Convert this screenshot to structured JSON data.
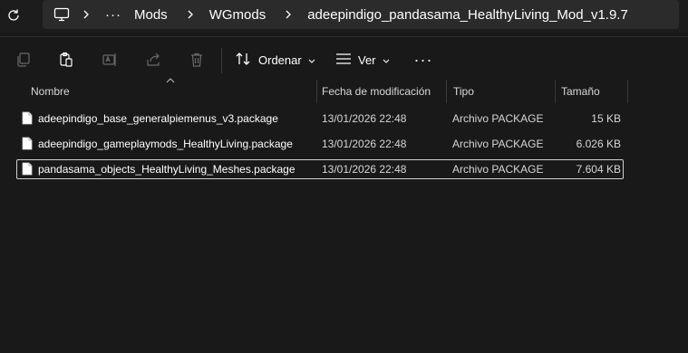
{
  "address": {
    "overflow_label": "···",
    "crumbs": [
      "Mods",
      "WGmods",
      "adeepindigo_pandasama_HealthyLiving_Mod_v1.9.7"
    ]
  },
  "toolbar": {
    "sort_label": "Ordenar",
    "view_label": "Ver",
    "more_label": "···"
  },
  "columns": {
    "name": "Nombre",
    "modified": "Fecha de modificación",
    "type": "Tipo",
    "size": "Tamaño"
  },
  "files": [
    {
      "name": "adeepindigo_base_generalpiemenus_v3.package",
      "modified": "13/01/2026 22:48",
      "type": "Archivo PACKAGE",
      "size": "15 KB"
    },
    {
      "name": "adeepindigo_gameplaymods_HealthyLiving.package",
      "modified": "13/01/2026 22:48",
      "type": "Archivo PACKAGE",
      "size": "6.026 KB"
    },
    {
      "name": "pandasama_objects_HealthyLiving_Meshes.package",
      "modified": "13/01/2026 22:48",
      "type": "Archivo PACKAGE",
      "size": "7.604 KB",
      "selected": true
    }
  ],
  "colors": {
    "background": "#191919",
    "address_box": "#2b2b2b",
    "disabled_icon": "#6a6a6a",
    "selection_border": "#d0d0d0"
  }
}
